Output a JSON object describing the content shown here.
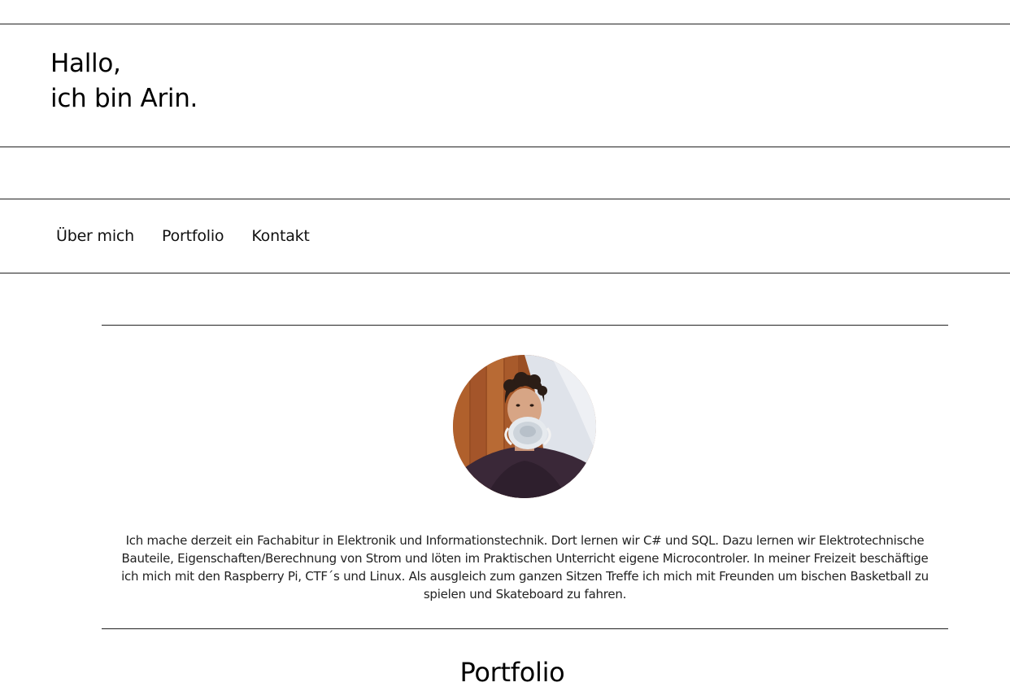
{
  "header": {
    "greeting_line1": "Hallo,",
    "greeting_line2": "ich bin Arin."
  },
  "nav": {
    "items": [
      {
        "label": "Über mich"
      },
      {
        "label": "Portfolio"
      },
      {
        "label": "Kontakt"
      }
    ]
  },
  "about": {
    "text": "Ich mache derzeit ein Fachabitur in Elektronik und Informationstechnik. Dort lernen wir C# und SQL. Dazu lernen wir Elektrotechnische Bauteile, Eigenschaften/Berechnung von Strom und löten im Praktischen Unterricht eigene Microcontroler. In meiner Freizeit beschäftige ich mich mit den Raspberry Pi, CTF´s und Linux. Als ausgleich zum ganzen Sitzen Treffe ich mich mit Freunden um bischen Basketball zu spielen und Skateboard zu fahren."
  },
  "portfolio": {
    "title": "Portfolio"
  },
  "colors": {
    "text": "#111111",
    "divider": "#222222",
    "background": "#ffffff"
  }
}
